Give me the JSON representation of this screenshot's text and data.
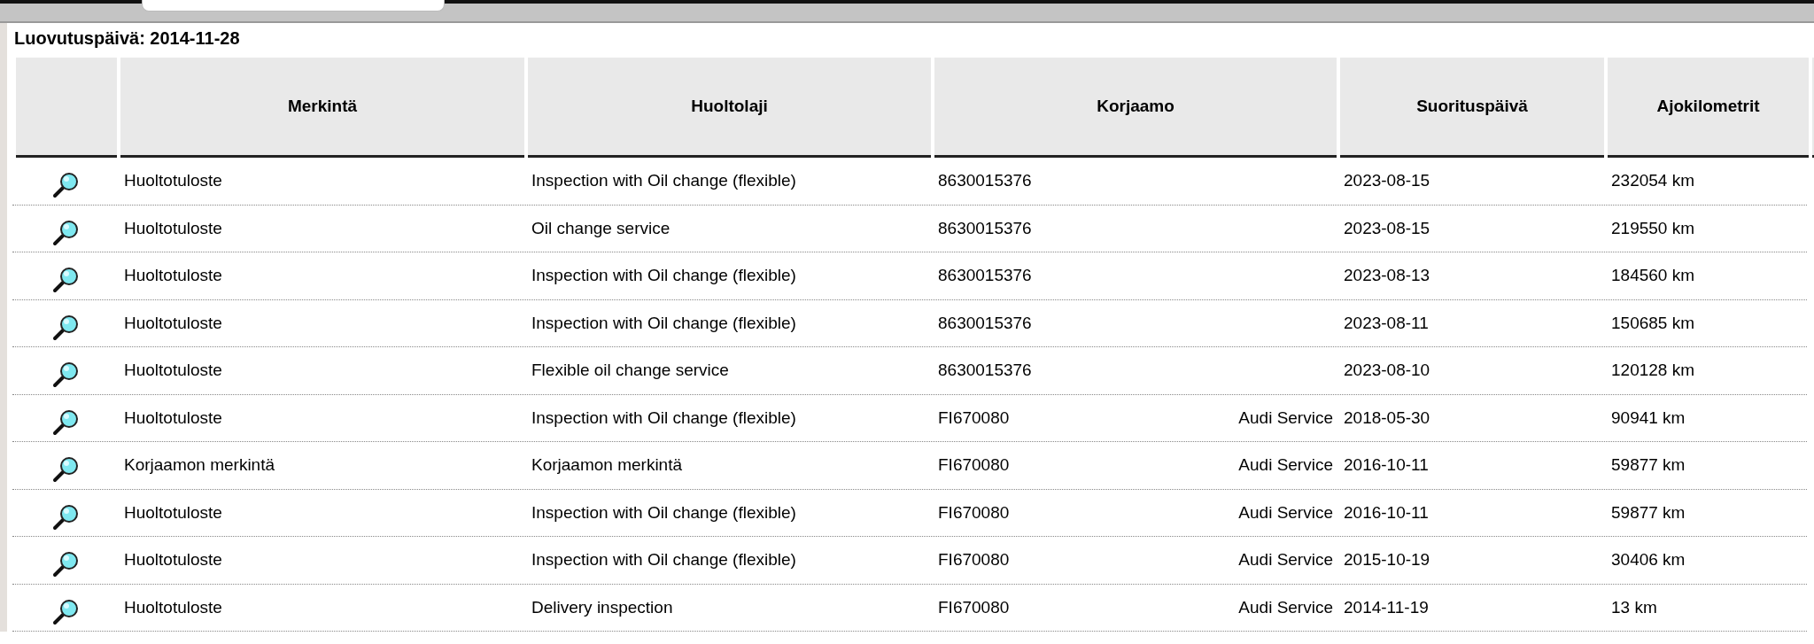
{
  "title": "Luovutuspäivä: 2014-11-28",
  "table": {
    "columns": [
      "Merkintä",
      "Huoltolaji",
      "Korjaamo",
      "Suorituspäivä",
      "Ajokilometrit"
    ],
    "rows": [
      {
        "merkinta": "Huoltotuloste",
        "huoltolaji": "Inspection with Oil change (flexible)",
        "korjaamo_code": "8630015376",
        "suorituspaiva": "2023-08-15",
        "ajokilometrit": "232054 km"
      },
      {
        "merkinta": "Huoltotuloste",
        "huoltolaji": "Oil change service",
        "korjaamo_code": "8630015376",
        "suorituspaiva": "2023-08-15",
        "ajokilometrit": "219550 km"
      },
      {
        "merkinta": "Huoltotuloste",
        "huoltolaji": "Inspection with Oil change (flexible)",
        "korjaamo_code": "8630015376",
        "suorituspaiva": "2023-08-13",
        "ajokilometrit": "184560 km"
      },
      {
        "merkinta": "Huoltotuloste",
        "huoltolaji": "Inspection with Oil change (flexible)",
        "korjaamo_code": "8630015376",
        "suorituspaiva": "2023-08-11",
        "ajokilometrit": "150685 km"
      },
      {
        "merkinta": "Huoltotuloste",
        "huoltolaji": "Flexible oil change service",
        "korjaamo_code": "8630015376",
        "suorituspaiva": "2023-08-10",
        "ajokilometrit": "120128 km"
      },
      {
        "merkinta": "Huoltotuloste",
        "huoltolaji": "Inspection with Oil change (flexible)",
        "korjaamo_code": "FI670080",
        "korjaamo_name": "Audi Service",
        "suorituspaiva": "2018-05-30",
        "ajokilometrit": "90941 km"
      },
      {
        "merkinta": "Korjaamon merkintä",
        "huoltolaji": "Korjaamon merkintä",
        "korjaamo_code": "FI670080",
        "korjaamo_name": "Audi Service",
        "suorituspaiva": "2016-10-11",
        "ajokilometrit": "59877 km"
      },
      {
        "merkinta": "Huoltotuloste",
        "huoltolaji": "Inspection with Oil change (flexible)",
        "korjaamo_code": "FI670080",
        "korjaamo_name": "Audi Service",
        "suorituspaiva": "2016-10-11",
        "ajokilometrit": "59877 km"
      },
      {
        "merkinta": "Huoltotuloste",
        "huoltolaji": "Inspection with Oil change (flexible)",
        "korjaamo_code": "FI670080",
        "korjaamo_name": "Audi Service",
        "suorituspaiva": "2015-10-19",
        "ajokilometrit": "30406 km"
      },
      {
        "merkinta": "Huoltotuloste",
        "huoltolaji": "Delivery inspection",
        "korjaamo_code": "FI670080",
        "korjaamo_name": "Audi Service",
        "suorituspaiva": "2014-11-19",
        "ajokilometrit": "13 km"
      }
    ]
  }
}
